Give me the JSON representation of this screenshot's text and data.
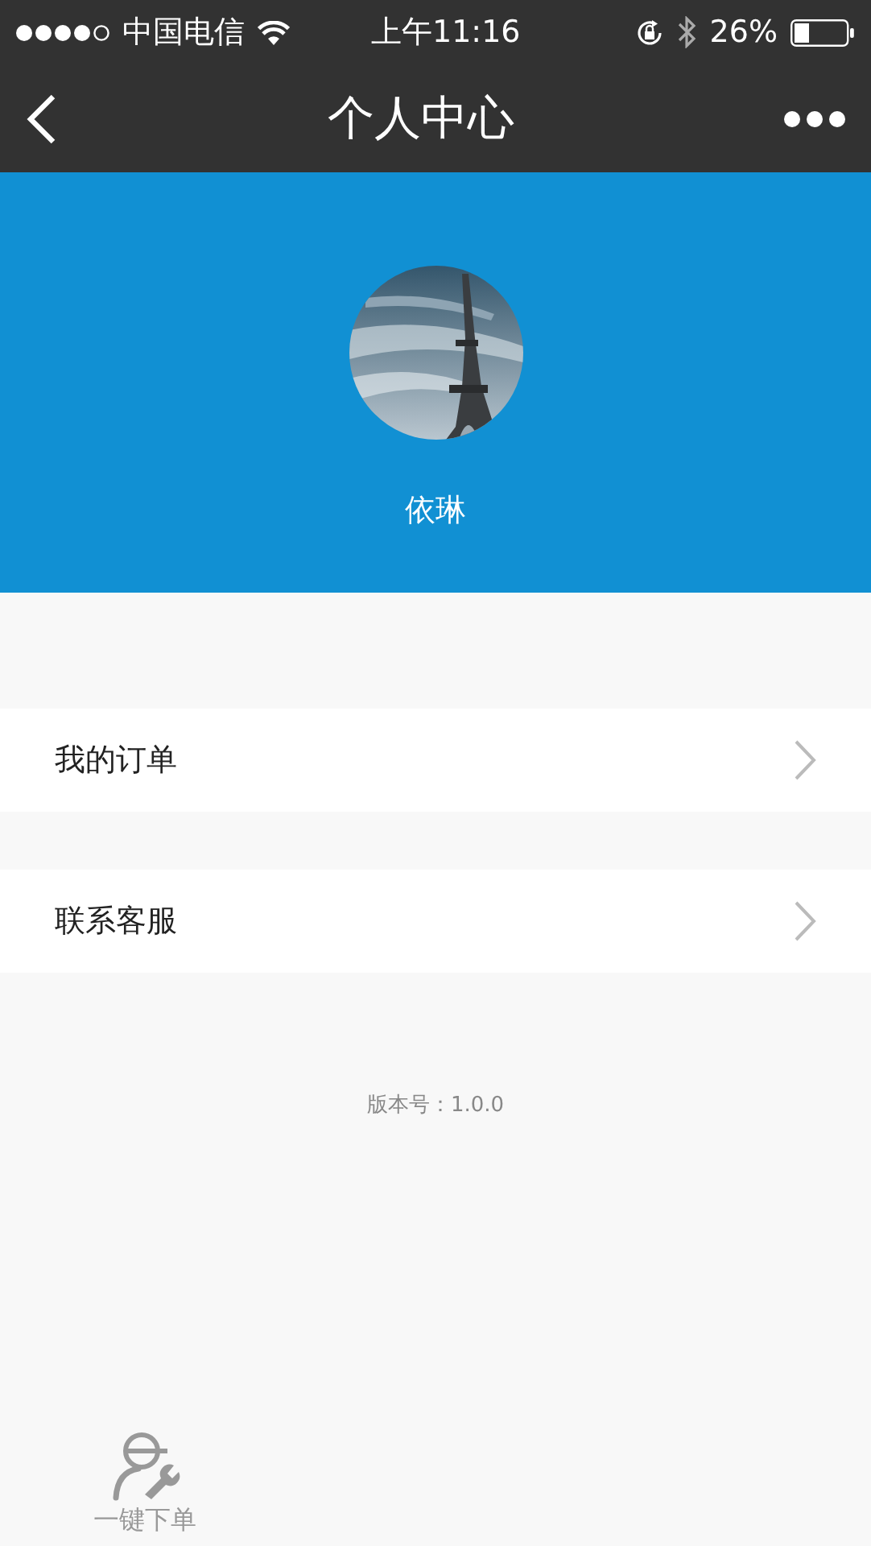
{
  "status_bar": {
    "carrier": "中国电信",
    "time": "上午11:16",
    "battery": "26%"
  },
  "nav_bar": {
    "title": "个人中心"
  },
  "profile": {
    "name": "依琳"
  },
  "menu": [
    {
      "label": "我的订单"
    },
    {
      "label": "联系客服"
    }
  ],
  "version": "版本号：1.0.0",
  "tab_bar": [
    {
      "label": "一键下单",
      "selected": false
    }
  ]
}
